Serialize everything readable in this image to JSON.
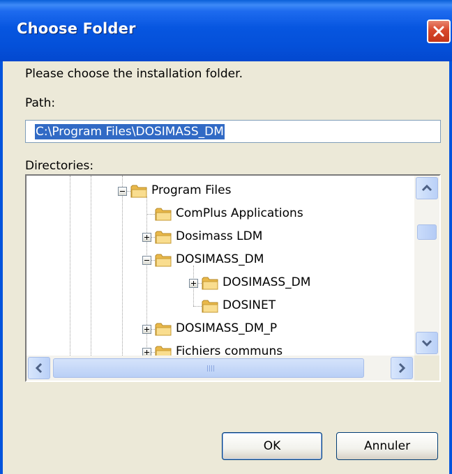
{
  "window": {
    "title": "Choose Folder"
  },
  "prompt": "Please choose the installation folder.",
  "path": {
    "label": "Path:",
    "value": "C:\\Program Files\\DOSIMASS_DM"
  },
  "directories": {
    "label": "Directories:",
    "items": [
      {
        "label": "Program Files",
        "expander": "minus"
      },
      {
        "label": "ComPlus Applications",
        "expander": "none"
      },
      {
        "label": "Dosimass LDM",
        "expander": "plus"
      },
      {
        "label": "DOSIMASS_DM",
        "expander": "minus"
      },
      {
        "label": "DOSIMASS_DM",
        "expander": "plus"
      },
      {
        "label": "DOSINET",
        "expander": "none"
      },
      {
        "label": "DOSIMASS_DM_P",
        "expander": "plus"
      },
      {
        "label": "Fichiers communs",
        "expander": "plus"
      }
    ]
  },
  "buttons": {
    "ok": "OK",
    "cancel": "Annuler"
  },
  "colors": {
    "title_bar": "#0054e3",
    "dialog_bg": "#ece9d8",
    "selection": "#316ac5",
    "close_button": "#d8482b",
    "folder": "#f5d47a"
  }
}
